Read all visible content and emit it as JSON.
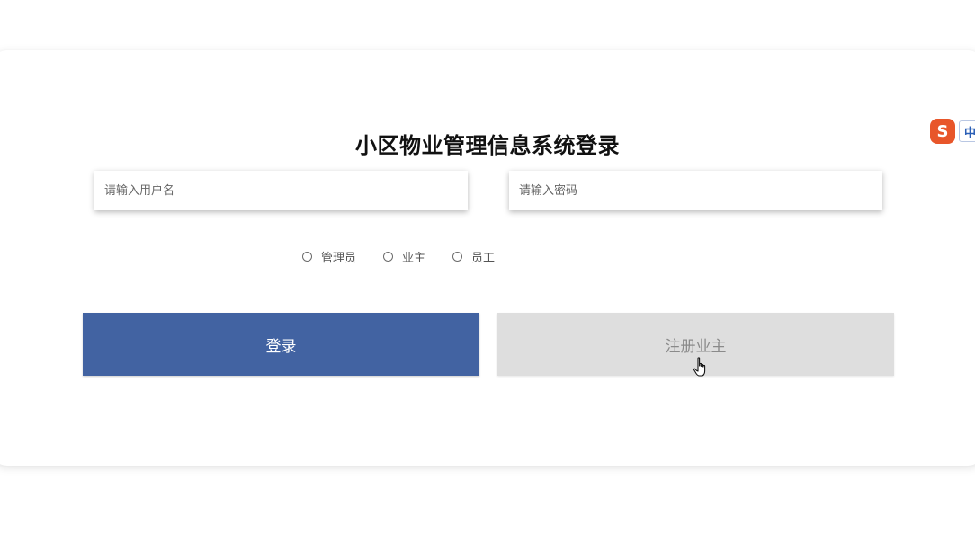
{
  "login": {
    "title": "小区物业管理信息系统登录",
    "username_placeholder": "请输入用户名",
    "password_placeholder": "请输入密码",
    "roles": [
      "管理员",
      "业主",
      "员工"
    ],
    "login_label": "登录",
    "register_label": "注册业主"
  },
  "ime": {
    "logo": "S",
    "mode": "中"
  },
  "colors": {
    "login_button": "#4263a2",
    "register_button": "#dedede",
    "ime_logo": "#e8562a"
  }
}
